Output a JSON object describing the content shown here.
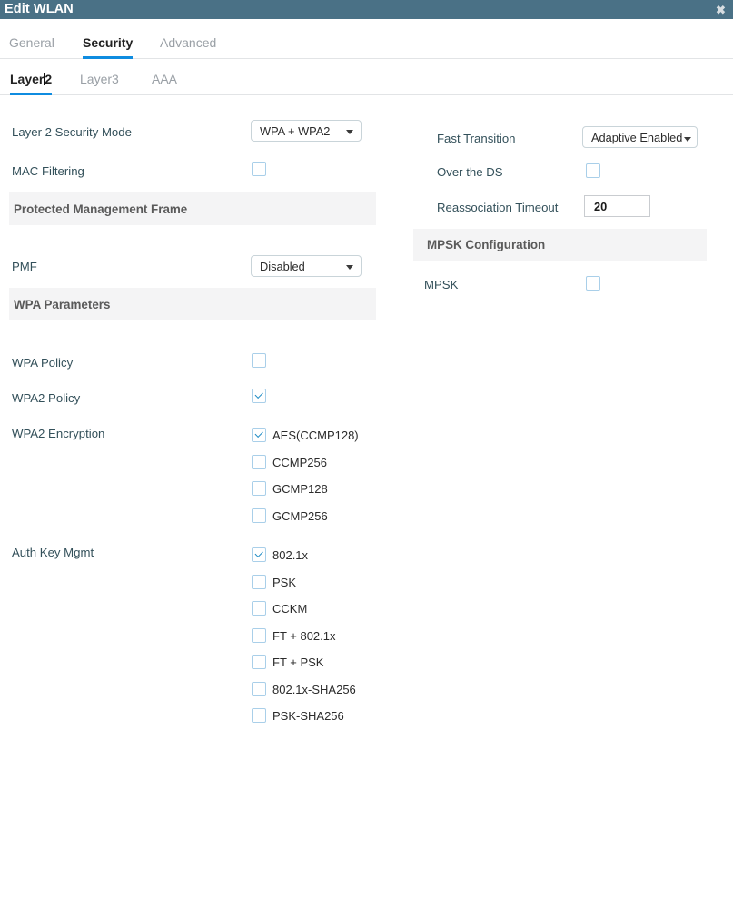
{
  "window": {
    "title": "Edit WLAN",
    "close_icon": "close-icon",
    "close_glyph": "✖",
    "header_color": "#4a7186",
    "accent_color": "#0f8ce0"
  },
  "main_tabs": [
    {
      "label": "General",
      "active": false
    },
    {
      "label": "Security",
      "active": true
    },
    {
      "label": "Advanced",
      "active": false
    }
  ],
  "sub_tabs": [
    {
      "label_before_caret": "Layer",
      "label_after_caret": "2",
      "label": "Layer2",
      "active": true
    },
    {
      "label": "Layer3",
      "active": false
    },
    {
      "label": "AAA",
      "active": false
    }
  ],
  "left_column": {
    "layer2_security_mode": {
      "label": "Layer 2 Security Mode",
      "value": "WPA + WPA2"
    },
    "mac_filtering": {
      "label": "MAC Filtering",
      "checked": false
    },
    "protected_management_frame_header": "Protected Management Frame",
    "pmf": {
      "label": "PMF",
      "value": "Disabled"
    },
    "wpa_parameters_header": "WPA Parameters",
    "wpa_policy": {
      "label": "WPA Policy",
      "checked": false
    },
    "wpa2_policy": {
      "label": "WPA2 Policy",
      "checked": true
    },
    "wpa2_encryption": {
      "label": "WPA2 Encryption",
      "options": [
        {
          "label": "AES(CCMP128)",
          "checked": true
        },
        {
          "label": "CCMP256",
          "checked": false
        },
        {
          "label": "GCMP128",
          "checked": false
        },
        {
          "label": "GCMP256",
          "checked": false
        }
      ]
    },
    "auth_key_mgmt": {
      "label": "Auth Key Mgmt",
      "options": [
        {
          "label": "802.1x",
          "checked": true
        },
        {
          "label": "PSK",
          "checked": false
        },
        {
          "label": "CCKM",
          "checked": false
        },
        {
          "label": "FT + 802.1x",
          "checked": false
        },
        {
          "label": "FT + PSK",
          "checked": false
        },
        {
          "label": "802.1x-SHA256",
          "checked": false
        },
        {
          "label": "PSK-SHA256",
          "checked": false
        }
      ]
    }
  },
  "right_column": {
    "fast_transition": {
      "label": "Fast Transition",
      "value": "Adaptive Enabled"
    },
    "over_the_ds": {
      "label": "Over the DS",
      "checked": false
    },
    "reassociation_timeout": {
      "label": "Reassociation Timeout",
      "value": "20"
    },
    "mpsk_configuration_header": "MPSK Configuration",
    "mpsk": {
      "label": "MPSK",
      "checked": false
    }
  }
}
